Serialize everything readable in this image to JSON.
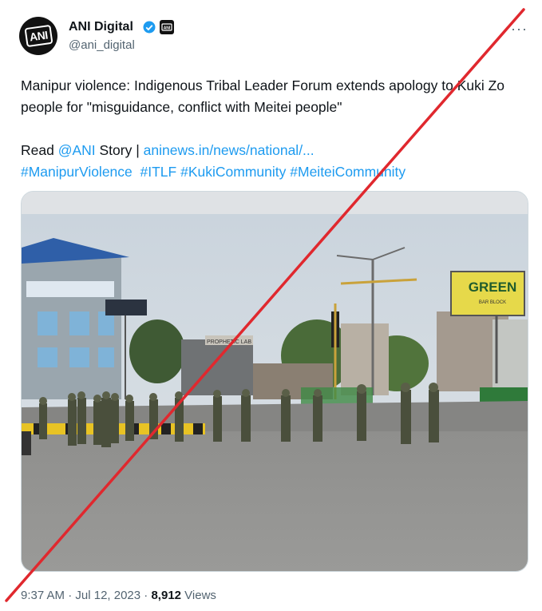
{
  "tweet": {
    "author_name": "ANI Digital",
    "avatar_text": "ANI",
    "handle": "@ani_digital",
    "more_label": "···",
    "text_line1": "Manipur violence: Indigenous Tribal Leader Forum extends apology to Kuki Zo people for \"misguidance, conflict with Meitei people\"",
    "read_prefix": "Read ",
    "mention": "@ANI",
    "read_mid": " Story | ",
    "link": "aninews.in/news/national/...",
    "hashtags": [
      "#ManipurViolence",
      "#ITLF",
      "#KukiCommunity",
      "#MeiteiCommunity"
    ],
    "time": "9:37 AM",
    "sep1": " · ",
    "date": "Jul 12, 2023",
    "sep2": " · ",
    "views_count": "8,912",
    "views_label": " Views"
  },
  "photo": {
    "billboard_text": "GREEN",
    "billboard_sub": "BAR BLOCK",
    "sign_text": "PROPHETIC LAB"
  },
  "colors": {
    "link": "#1d9bf0",
    "verified": "#1d9bf0",
    "slash": "#e0282e",
    "muted": "#536471"
  }
}
